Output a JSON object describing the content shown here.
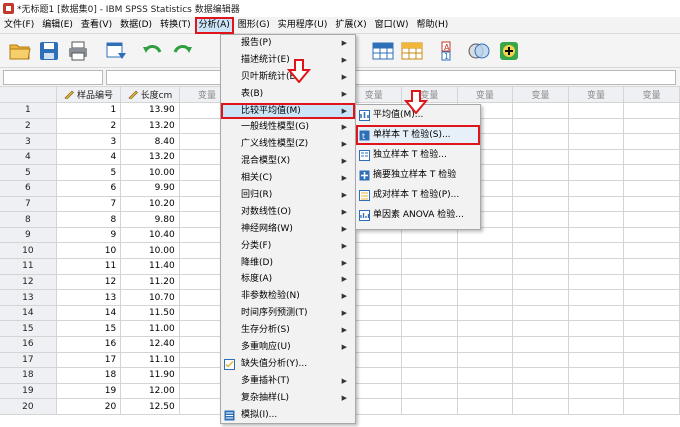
{
  "window": {
    "title": "*无标题1 [数据集0] - IBM SPSS Statistics 数据编辑器"
  },
  "menubar": [
    {
      "label": "文件(F)"
    },
    {
      "label": "编辑(E)"
    },
    {
      "label": "查看(V)"
    },
    {
      "label": "数据(D)"
    },
    {
      "label": "转换(T)"
    },
    {
      "label": "分析(A)"
    },
    {
      "label": "图形(G)"
    },
    {
      "label": "实用程序(U)"
    },
    {
      "label": "扩展(X)"
    },
    {
      "label": "窗口(W)"
    },
    {
      "label": "帮助(H)"
    }
  ],
  "toolbar": [
    {
      "icon": "open-folder-icon"
    },
    {
      "icon": "save-icon"
    },
    {
      "icon": "print-icon"
    },
    {
      "icon": "dialog-recall-icon"
    },
    {
      "icon": "undo-icon"
    },
    {
      "icon": "redo-icon"
    },
    {
      "icon": "variables-grid-icon"
    },
    {
      "icon": "cases-grid-icon"
    },
    {
      "icon": "value-labels-icon"
    },
    {
      "icon": "use-sets-icon"
    },
    {
      "icon": "add-icon"
    }
  ],
  "grid": {
    "columns": [
      "样品编号",
      "长度cm",
      "变量",
      "变量",
      "变量",
      "变量",
      "变量",
      "变量",
      "变量",
      "变量",
      "变量"
    ],
    "rows": [
      {
        "n": "1",
        "id": "1",
        "len": "13.90"
      },
      {
        "n": "2",
        "id": "2",
        "len": "13.20"
      },
      {
        "n": "3",
        "id": "3",
        "len": "8.40"
      },
      {
        "n": "4",
        "id": "4",
        "len": "13.20"
      },
      {
        "n": "5",
        "id": "5",
        "len": "10.00"
      },
      {
        "n": "6",
        "id": "6",
        "len": "9.90"
      },
      {
        "n": "7",
        "id": "7",
        "len": "10.20"
      },
      {
        "n": "8",
        "id": "8",
        "len": "9.80"
      },
      {
        "n": "9",
        "id": "9",
        "len": "10.40"
      },
      {
        "n": "10",
        "id": "10",
        "len": "10.00"
      },
      {
        "n": "11",
        "id": "11",
        "len": "11.40"
      },
      {
        "n": "12",
        "id": "12",
        "len": "11.20"
      },
      {
        "n": "13",
        "id": "13",
        "len": "10.70"
      },
      {
        "n": "14",
        "id": "14",
        "len": "11.50"
      },
      {
        "n": "15",
        "id": "15",
        "len": "11.00"
      },
      {
        "n": "16",
        "id": "16",
        "len": "12.40"
      },
      {
        "n": "17",
        "id": "17",
        "len": "11.10"
      },
      {
        "n": "18",
        "id": "18",
        "len": "11.90"
      },
      {
        "n": "19",
        "id": "19",
        "len": "12.00"
      },
      {
        "n": "20",
        "id": "20",
        "len": "12.50"
      }
    ]
  },
  "analyze_menu": [
    {
      "label": "报告(P)",
      "arrow": true
    },
    {
      "label": "描述统计(E)",
      "arrow": true
    },
    {
      "label": "贝叶斯统计(B)",
      "arrow": true
    },
    {
      "label": "表(B)",
      "arrow": true
    },
    {
      "label": "比较平均值(M)",
      "arrow": true,
      "highlight": true
    },
    {
      "label": "一般线性模型(G)",
      "arrow": true
    },
    {
      "label": "广义线性模型(Z)",
      "arrow": true
    },
    {
      "label": "混合模型(X)",
      "arrow": true
    },
    {
      "label": "相关(C)",
      "arrow": true
    },
    {
      "label": "回归(R)",
      "arrow": true
    },
    {
      "label": "对数线性(O)",
      "arrow": true
    },
    {
      "label": "神经网络(W)",
      "arrow": true
    },
    {
      "label": "分类(F)",
      "arrow": true
    },
    {
      "label": "降维(D)",
      "arrow": true
    },
    {
      "label": "标度(A)",
      "arrow": true
    },
    {
      "label": "非参数检验(N)",
      "arrow": true
    },
    {
      "label": "时间序列预测(T)",
      "arrow": true
    },
    {
      "label": "生存分析(S)",
      "arrow": true
    },
    {
      "label": "多重响应(U)",
      "arrow": true
    },
    {
      "label": "缺失值分析(Y)...",
      "arrow": false,
      "icon": "missing-value-icon"
    },
    {
      "label": "多重插补(T)",
      "arrow": true
    },
    {
      "label": "复杂抽样(L)",
      "arrow": true
    },
    {
      "label": "模拟(I)...",
      "arrow": false,
      "icon": "simulation-icon"
    }
  ],
  "compare_means_menu": [
    {
      "label": "平均值(M)...",
      "icon": "means-icon"
    },
    {
      "label": "单样本 T 检验(S)...",
      "icon": "one-sample-t-icon",
      "highlight": true
    },
    {
      "label": "独立样本 T 检验...",
      "icon": "independent-t-icon"
    },
    {
      "label": "摘要独立样本 T 检验",
      "icon": "summary-t-icon"
    },
    {
      "label": "成对样本 T 检验(P)...",
      "icon": "paired-t-icon"
    },
    {
      "label": "单因素 ANOVA 检验...",
      "icon": "anova-icon"
    }
  ],
  "colors": {
    "highlight_border": "#e0141b",
    "menu_hover": "#cce4f7"
  }
}
